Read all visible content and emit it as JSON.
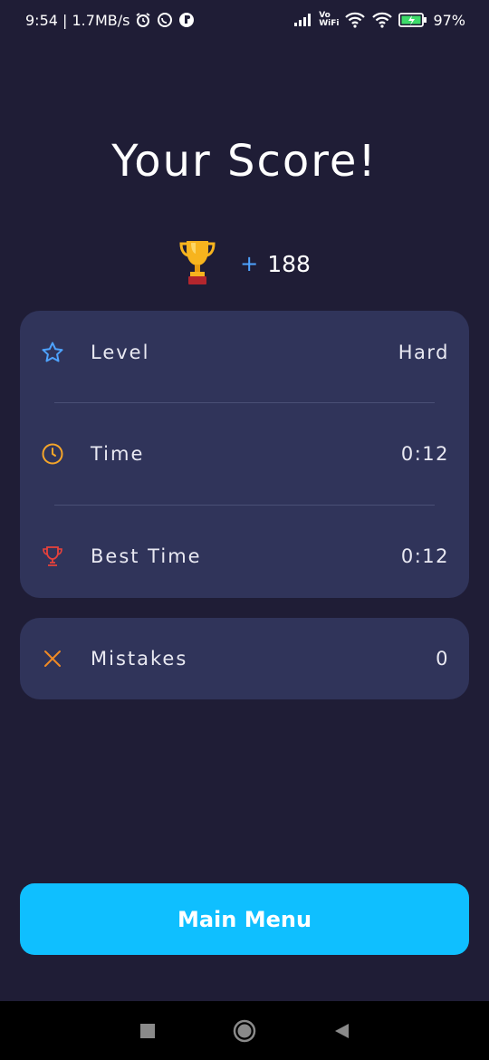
{
  "status_bar": {
    "time_speed": "9:54 | 1.7MB/s",
    "vo": "Vo",
    "wifi": "WiFi",
    "battery_percent": "97%"
  },
  "title": "Your Score!",
  "score": {
    "plus": "+",
    "value": "188",
    "icon": "trophy-icon"
  },
  "stats": {
    "level": {
      "icon": "star-icon",
      "label": "Level",
      "value": "Hard"
    },
    "time": {
      "icon": "clock-icon",
      "label": "Time",
      "value": "0:12"
    },
    "best_time": {
      "icon": "trophy-outline-icon",
      "label": "Best Time",
      "value": "0:12"
    },
    "mistakes": {
      "icon": "x-icon",
      "label": "Mistakes",
      "value": "0"
    }
  },
  "main_menu_button": "Main Menu",
  "nav": {
    "recents_icon": "square-icon",
    "home_icon": "circle-icon",
    "back_icon": "triangle-back-icon"
  },
  "colors": {
    "background": "#1f1d36",
    "card": "#30345a",
    "accent": "#0fbfff",
    "star": "#4ea3ff",
    "clock": "#f4a52a",
    "trophy_outline": "#e8413b",
    "x": "#f08a24"
  }
}
